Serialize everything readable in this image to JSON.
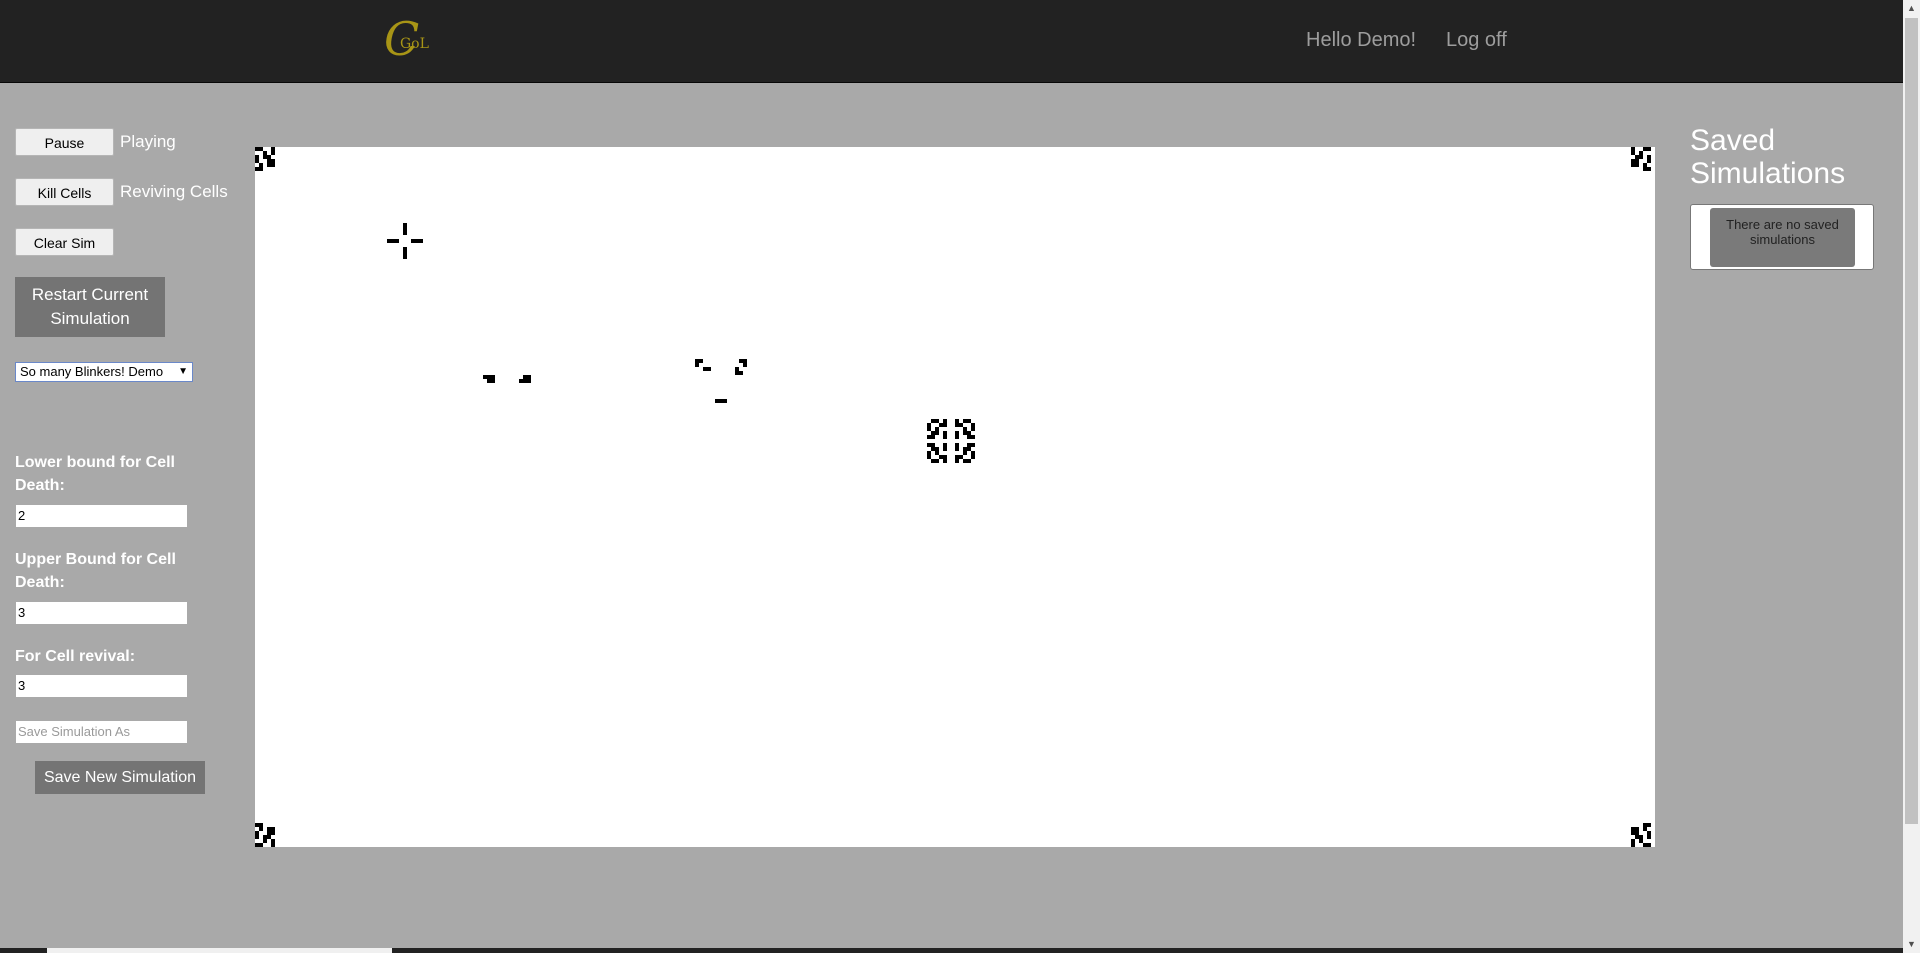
{
  "navbar": {
    "brand_c": "C",
    "brand_text": "GoL",
    "greeting": "Hello Demo!",
    "logoff": "Log off"
  },
  "controls": {
    "pause_label": "Pause",
    "play_state": "Playing",
    "kill_label": "Kill Cells",
    "kill_state": "Reviving Cells",
    "clear_label": "Clear Sim",
    "restart_label": "Restart Current Simulation",
    "preset_selected": "So many Blinkers! Demo",
    "lower_bound_label": "Lower bound for Cell Death:",
    "lower_bound_value": "2",
    "upper_bound_label": "Upper Bound for Cell Death:",
    "upper_bound_value": "3",
    "revival_label": "For Cell revival:",
    "revival_value": "3",
    "save_as_placeholder": "Save Simulation As",
    "save_new_label": "Save New Simulation"
  },
  "saved": {
    "title": "Saved Simulations",
    "empty_text": "There are no saved simulations"
  },
  "colors": {
    "navbar": "#222222",
    "page_bg": "#a9a9a9",
    "brand": "#a89516",
    "cell": "#000000",
    "board": "#ffffff"
  },
  "board_icon": "game-of-life-grid"
}
